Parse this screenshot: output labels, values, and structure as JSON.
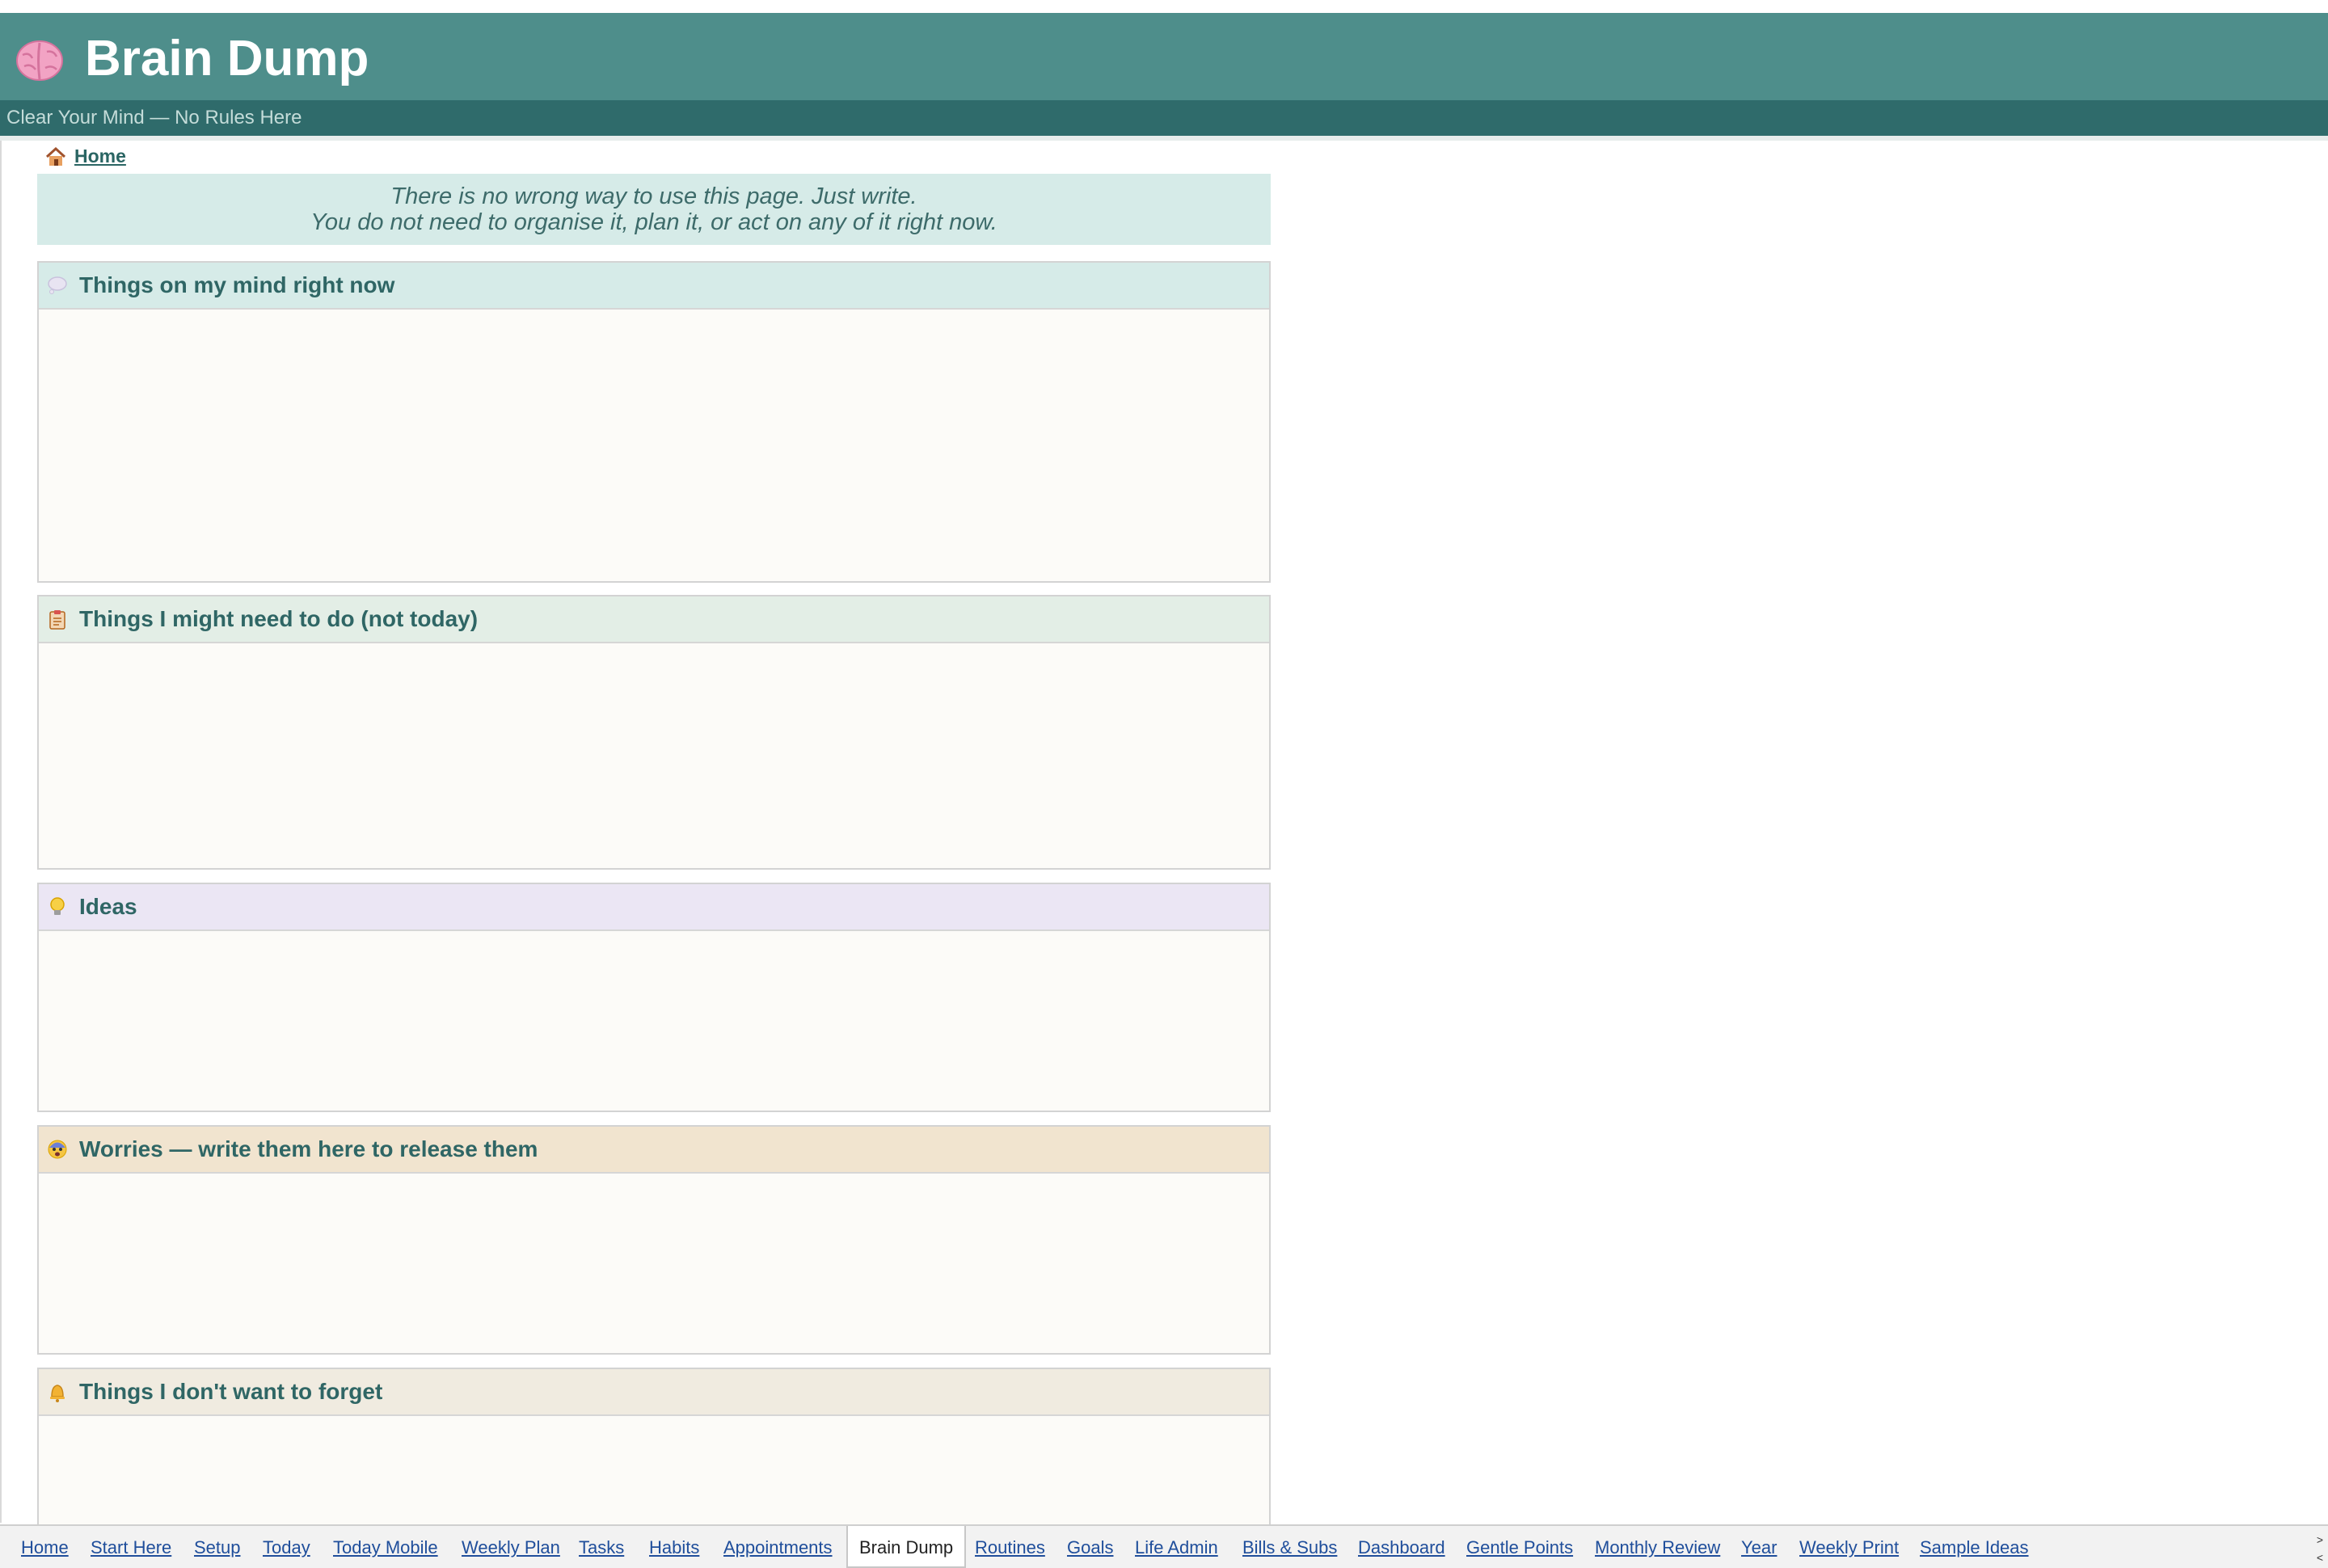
{
  "header": {
    "title": "Brain Dump",
    "subtitle": "Clear Your Mind — No Rules Here",
    "icon": "brain-icon"
  },
  "breadcrumb": {
    "home_label": "Home",
    "icon": "house-icon"
  },
  "intro": {
    "line1": "There is no wrong way to use this page. Just write.",
    "line2": "You do not need to organise it, plan it, or act on any of it right now."
  },
  "sections": [
    {
      "title": "Things on my mind right now",
      "icon": "thought-bubble-icon",
      "header_color": "#d6ebe8"
    },
    {
      "title": "Things I might need to do (not today)",
      "icon": "clipboard-icon",
      "header_color": "#e3eee6"
    },
    {
      "title": "Ideas",
      "icon": "lightbulb-icon",
      "header_color": "#ebe6f4"
    },
    {
      "title": "Worries — write them here to release them",
      "icon": "worried-face-icon",
      "header_color": "#f1e4cf"
    },
    {
      "title": "Things I don't want to forget",
      "icon": "bell-icon",
      "header_color": "#f0ebe0"
    }
  ],
  "tabs": [
    "Home",
    "Start Here",
    "Setup",
    "Today",
    "Today Mobile",
    "Weekly Plan",
    "Tasks",
    "Habits",
    "Appointments",
    "Brain Dump",
    "Routines",
    "Goals",
    "Life Admin",
    "Bills & Subs",
    "Dashboard",
    "Gentle Points",
    "Monthly Review",
    "Year",
    "Weekly Print",
    "Sample Ideas"
  ],
  "active_tab": "Brain Dump",
  "scroll": {
    "right": ">",
    "left": "<"
  }
}
